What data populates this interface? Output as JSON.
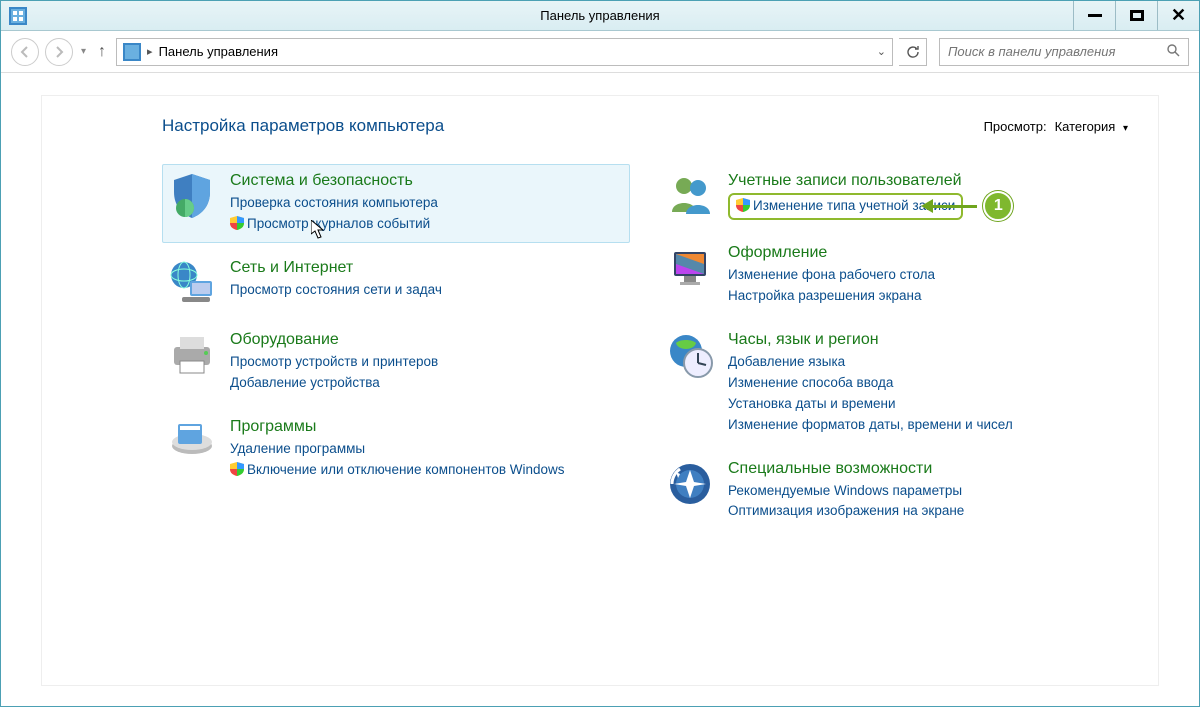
{
  "window": {
    "title": "Панель управления"
  },
  "breadcrumb": {
    "root": "Панель управления"
  },
  "search": {
    "placeholder": "Поиск в панели управления"
  },
  "heading": "Настройка параметров компьютера",
  "view": {
    "label": "Просмотр:",
    "value": "Категория"
  },
  "annotation": {
    "number": "1"
  },
  "left": [
    {
      "title": "Система и безопасность",
      "links": [
        {
          "text": "Проверка состояния компьютера",
          "shield": false
        },
        {
          "text": "Просмотр журналов событий",
          "shield": true
        }
      ]
    },
    {
      "title": "Сеть и Интернет",
      "links": [
        {
          "text": "Просмотр состояния сети и задач",
          "shield": false
        }
      ]
    },
    {
      "title": "Оборудование",
      "links": [
        {
          "text": "Просмотр устройств и принтеров",
          "shield": false
        },
        {
          "text": "Добавление устройства",
          "shield": false
        }
      ]
    },
    {
      "title": "Программы",
      "links": [
        {
          "text": "Удаление программы",
          "shield": false
        },
        {
          "text": "Включение или отключение компонентов Windows",
          "shield": true
        }
      ]
    }
  ],
  "right": [
    {
      "title": "Учетные записи пользователей",
      "links": [
        {
          "text": "Изменение типа учетной записи",
          "shield": true,
          "annotated": true
        }
      ]
    },
    {
      "title": "Оформление",
      "links": [
        {
          "text": "Изменение фона рабочего стола",
          "shield": false
        },
        {
          "text": "Настройка разрешения экрана",
          "shield": false
        }
      ]
    },
    {
      "title": "Часы, язык и регион",
      "links": [
        {
          "text": "Добавление языка",
          "shield": false
        },
        {
          "text": "Изменение способа ввода",
          "shield": false
        },
        {
          "text": "Установка даты и времени",
          "shield": false
        },
        {
          "text": "Изменение форматов даты, времени и чисел",
          "shield": false
        }
      ]
    },
    {
      "title": "Специальные возможности",
      "links": [
        {
          "text": "Рекомендуемые Windows параметры",
          "shield": false
        },
        {
          "text": "Оптимизация изображения на экране",
          "shield": false
        }
      ]
    }
  ]
}
